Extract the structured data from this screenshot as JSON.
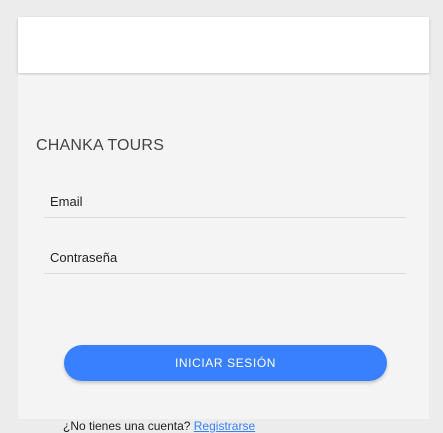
{
  "header": {
    "title": ""
  },
  "brand": {
    "title": "CHANKA TOURS"
  },
  "form": {
    "email": {
      "placeholder": "Email",
      "value": ""
    },
    "password": {
      "placeholder": "Contraseña",
      "value": ""
    },
    "submit_label": "INICIAR SESIÓN"
  },
  "signup": {
    "prompt": "¿No tienes una cuenta?",
    "link_label": "Registrarse"
  },
  "colors": {
    "accent": "#3880ff",
    "page_background": "#ececec",
    "card_background": "#f4f4f4"
  }
}
